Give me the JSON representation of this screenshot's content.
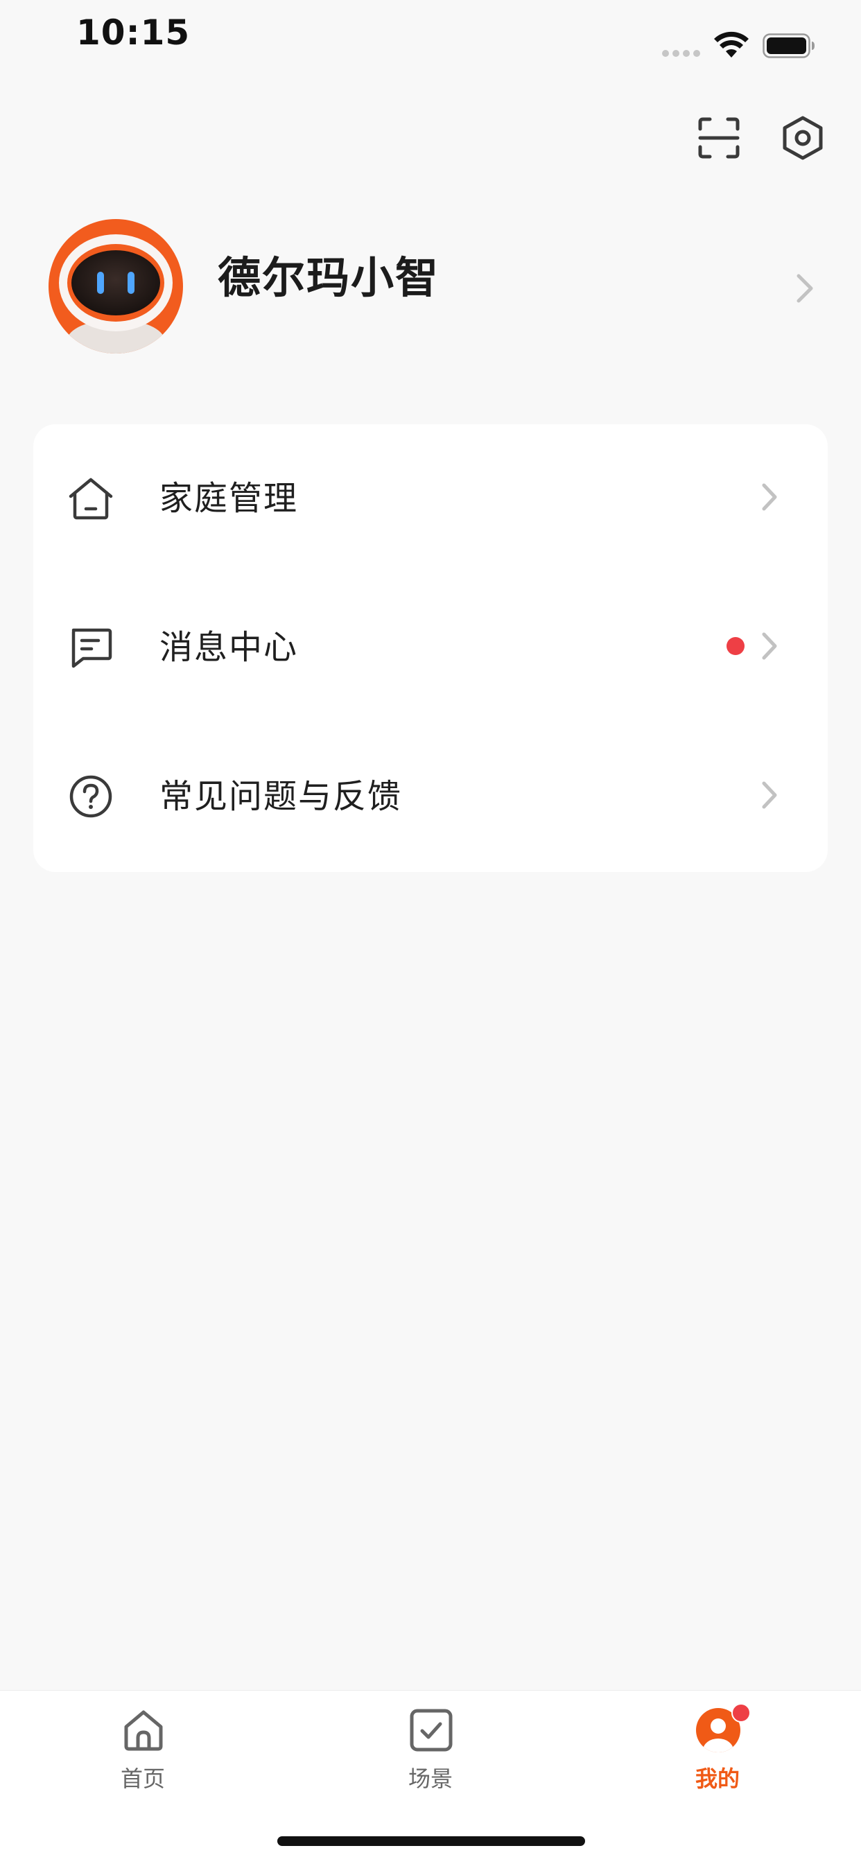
{
  "status_bar": {
    "time": "10:15"
  },
  "header": {
    "scan_icon": "scan-icon",
    "settings_icon": "hexagon-settings-icon"
  },
  "profile": {
    "name": "德尔玛小智",
    "avatar_icon": "robot-avatar"
  },
  "menu": {
    "items": [
      {
        "label": "家庭管理",
        "icon": "home-outline-icon",
        "has_dot": false
      },
      {
        "label": "消息中心",
        "icon": "message-icon",
        "has_dot": true
      },
      {
        "label": "常见问题与反馈",
        "icon": "question-circle-icon",
        "has_dot": false
      }
    ]
  },
  "tab_bar": {
    "tabs": [
      {
        "label": "首页",
        "icon": "home-icon",
        "active": false
      },
      {
        "label": "场景",
        "icon": "checkbox-icon",
        "active": false
      },
      {
        "label": "我的",
        "icon": "user-icon",
        "active": true,
        "badge": true
      }
    ]
  },
  "colors": {
    "accent": "#f05a16",
    "badge": "#ee3f45",
    "background": "#f8f8f8",
    "card": "#ffffff"
  }
}
